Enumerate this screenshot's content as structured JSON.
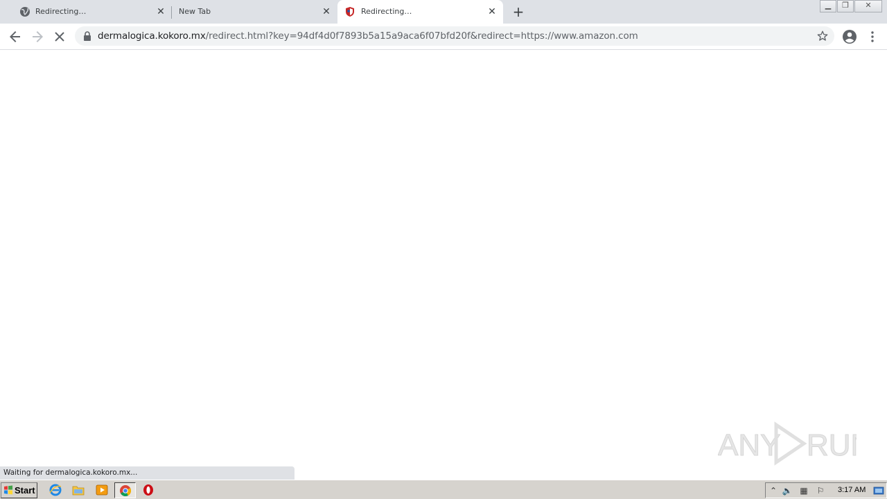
{
  "browser": {
    "tabs": [
      {
        "title": "Redirecting…",
        "icon": "globe-icon",
        "active": false
      },
      {
        "title": "New Tab",
        "icon": "",
        "active": false
      },
      {
        "title": "Redirecting…",
        "icon": "shield-favicon-icon",
        "active": true
      }
    ],
    "address_bar": {
      "host": "dermalogica.kokoro.mx",
      "path": "/redirect.html?key=94df4d0f7893b5a15a9aca6f07bfd20f&redirect=https://www.amazon.com"
    },
    "status_text": "Waiting for dermalogica.kokoro.mx..."
  },
  "watermark": {
    "text": "ANY RUN"
  },
  "taskbar": {
    "start_label": "Start",
    "quick_launch": [
      "internet-explorer-icon",
      "folder-icon",
      "media-player-icon",
      "chrome-icon",
      "opera-icon"
    ],
    "clock": "3:17 AM"
  },
  "colors": {
    "tabstrip": "#dee1e6",
    "omnibox": "#f1f3f4",
    "taskbar": "#d6d3ce"
  }
}
